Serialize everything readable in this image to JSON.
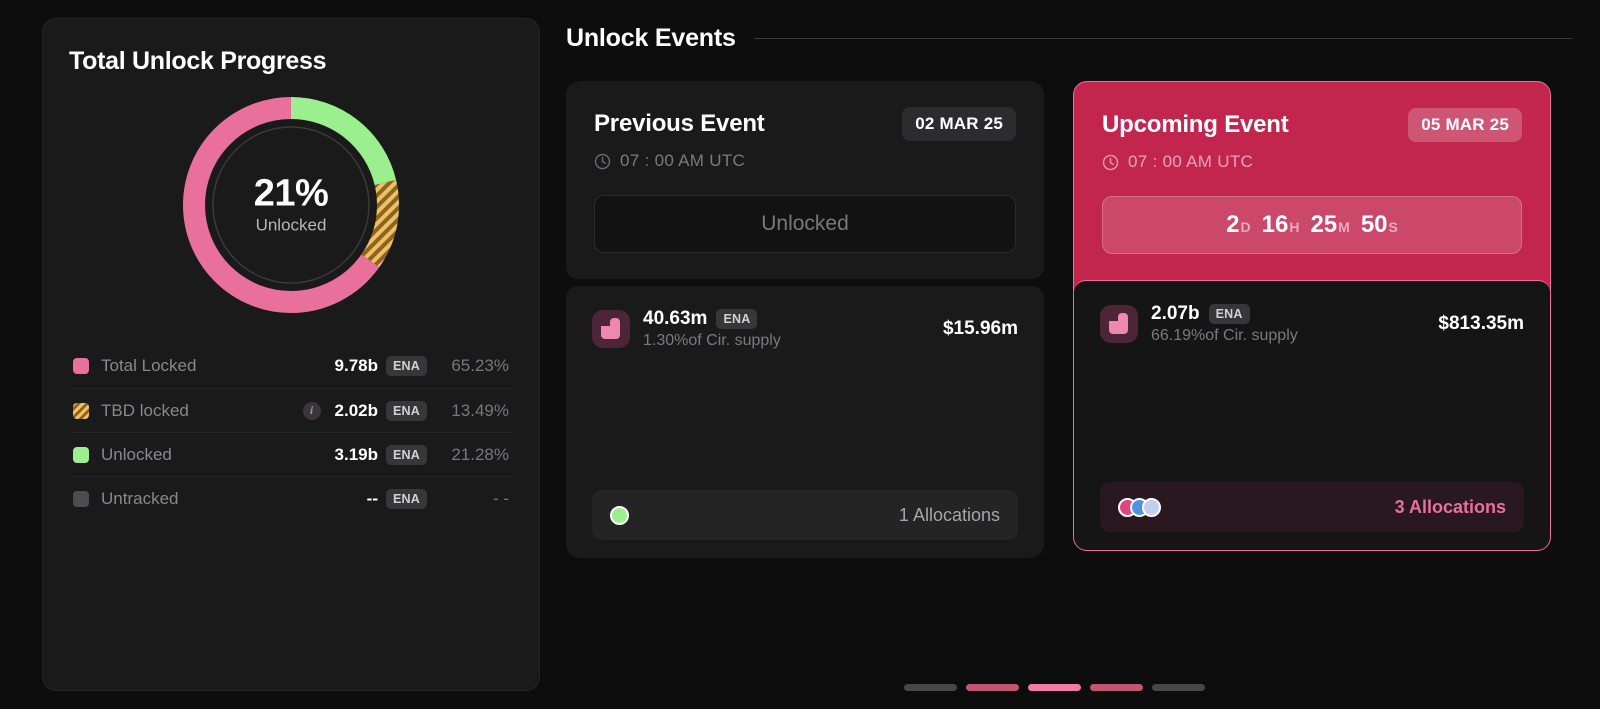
{
  "progress_panel": {
    "title": "Total Unlock Progress",
    "donut": {
      "center_value": "21%",
      "center_label": "Unlocked"
    },
    "legend": [
      {
        "swatch": "pink-square",
        "label": "Total Locked",
        "value": "9.78b",
        "ticker": "ENA",
        "percent": "65.23%"
      },
      {
        "swatch": "striped-square",
        "label": "TBD locked",
        "info_icon": "info-icon",
        "value": "2.02b",
        "ticker": "ENA",
        "percent": "13.49%"
      },
      {
        "swatch": "green-square",
        "label": "Unlocked",
        "value": "3.19b",
        "ticker": "ENA",
        "percent": "21.28%"
      },
      {
        "swatch": "gray-square",
        "label": "Untracked",
        "value": "--",
        "ticker": "ENA",
        "percent": "- -"
      }
    ]
  },
  "events": {
    "title": "Unlock Events",
    "previous": {
      "name": "Previous Event",
      "date": "02 MAR 25",
      "clock_icon": "clock-icon",
      "time": "07 : 00 AM UTC",
      "status_label": "Unlocked",
      "token": {
        "icon": "ena-token-icon",
        "amount": "40.63m",
        "ticker": "ENA",
        "supply": "1.30%of Cir. supply",
        "usd": "$15.96m"
      },
      "allocations": {
        "label": "1 Allocations",
        "dots": [
          "#9cef8f"
        ]
      }
    },
    "upcoming": {
      "name": "Upcoming Event",
      "date": "05 MAR 25",
      "clock_icon": "clock-icon",
      "time": "07 : 00 AM UTC",
      "countdown": {
        "days": "2",
        "days_unit": "D",
        "hours": "16",
        "hours_unit": "H",
        "minutes": "25",
        "minutes_unit": "M",
        "seconds": "50",
        "seconds_unit": "S"
      },
      "token": {
        "icon": "ena-token-icon",
        "amount": "2.07b",
        "ticker": "ENA",
        "supply": "66.19%of Cir. supply",
        "usd": "$813.35m"
      },
      "allocations": {
        "label": "3 Allocations",
        "dots": [
          "#e0447f",
          "#4f92e0",
          "#c3cdf2"
        ]
      }
    },
    "pagination": {
      "count": 5,
      "active_index": 2
    }
  },
  "chart_data": {
    "type": "pie",
    "title": "Total Unlock Progress",
    "categories": [
      "Unlocked",
      "TBD locked",
      "Total Locked"
    ],
    "values": [
      21.28,
      13.49,
      65.23
    ],
    "colors": [
      "#9cef8f",
      "#e8b457",
      "#e8709b"
    ],
    "units": "percent",
    "amounts": [
      "3.19b",
      "2.02b",
      "9.78b"
    ],
    "center_value": 21,
    "legend": "right-list",
    "start_angle": 0,
    "direction": "clockwise"
  },
  "theme": {
    "accent_pink": "#e8709b",
    "accent_green": "#9cef8f",
    "accent_gold": "#f0c164",
    "card_bg": "#1a1a1b",
    "page_bg": "#0d0d0e",
    "upcoming_bg": "#c2264f"
  }
}
